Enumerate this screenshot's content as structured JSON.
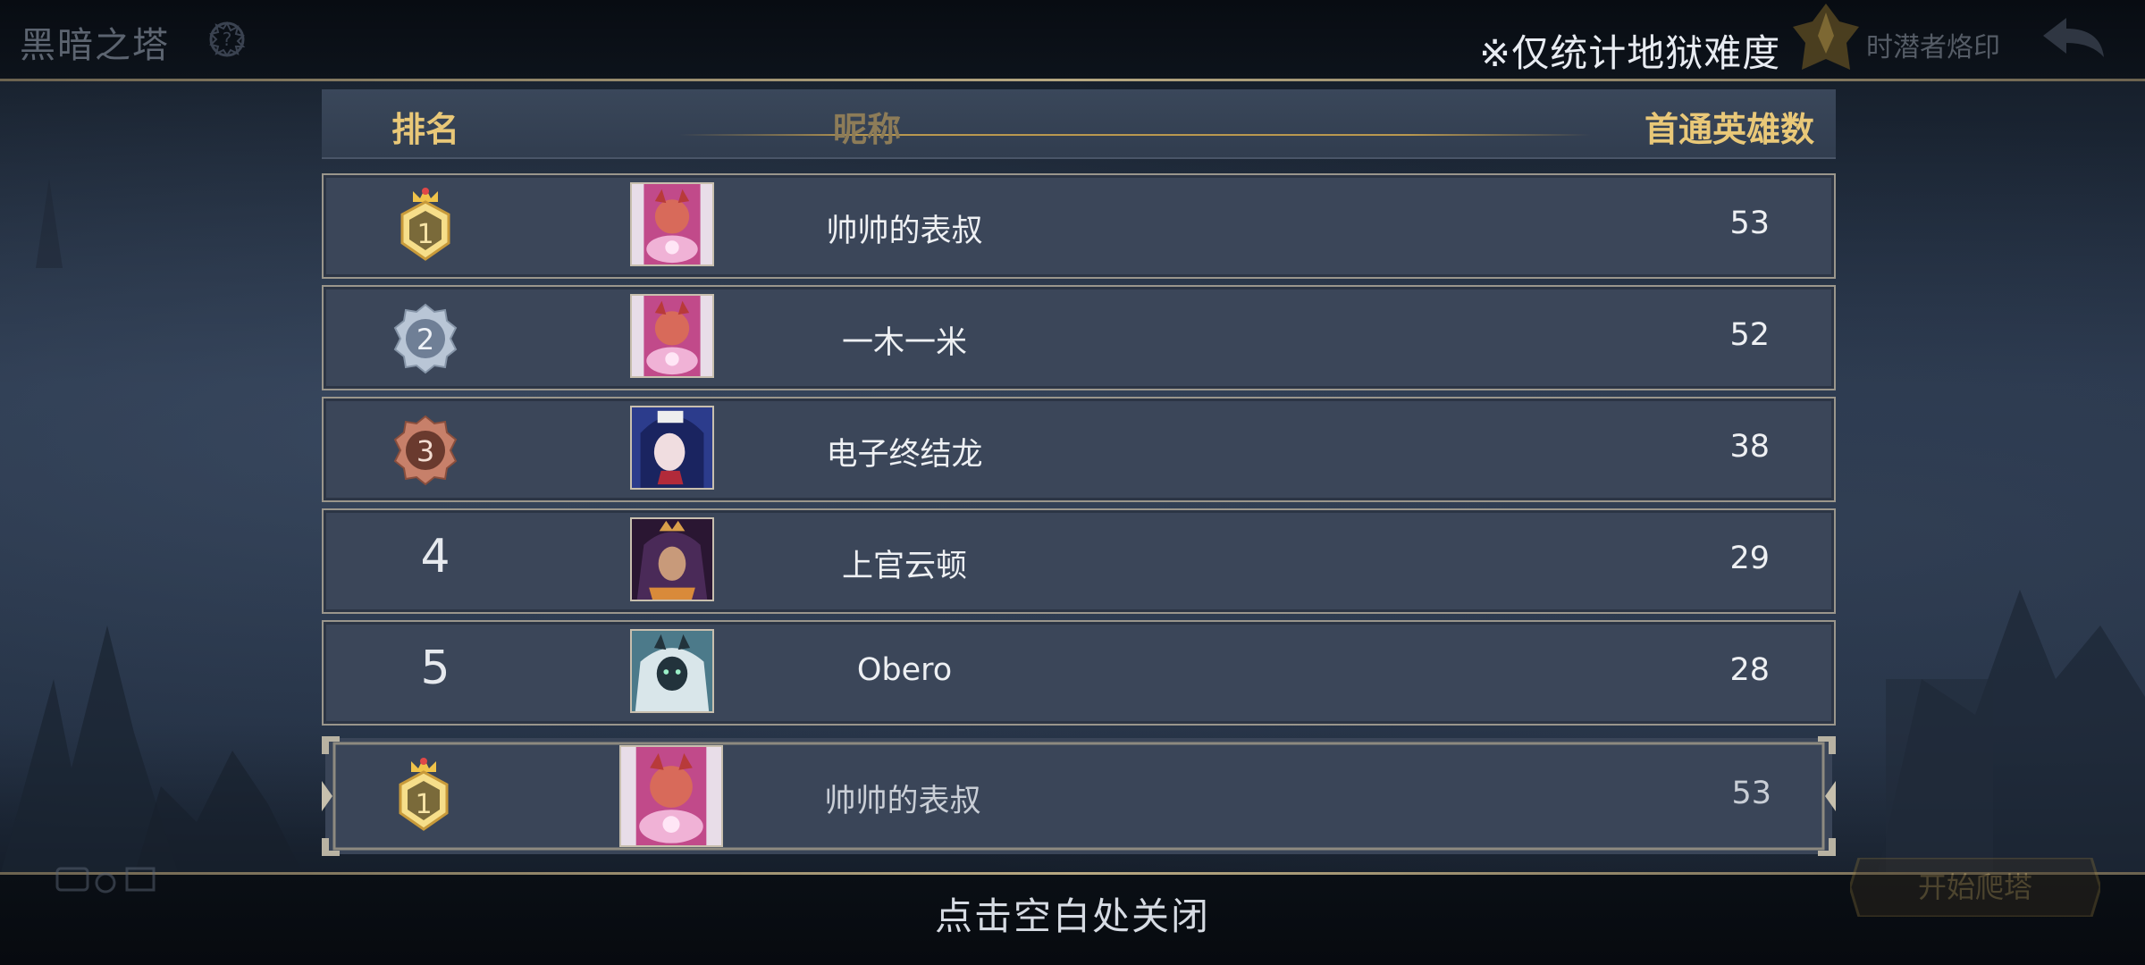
{
  "topbar": {
    "title": "黑暗之塔",
    "note": "※仅统计地狱难度",
    "brand_label": "时潜者烙印"
  },
  "header": {
    "rank": "排名",
    "nickname": "昵称",
    "count": "首通英雄数"
  },
  "rows": [
    {
      "rank": "1",
      "medal": "gold",
      "name": "帅帅的表叔",
      "count": "53",
      "avatar_colors": [
        "#c14a8a",
        "#f0b2d6",
        "#7a2a5c"
      ]
    },
    {
      "rank": "2",
      "medal": "silver",
      "name": "一木一米",
      "count": "52",
      "avatar_colors": [
        "#c14a8a",
        "#f0b2d6",
        "#7a2a5c"
      ]
    },
    {
      "rank": "3",
      "medal": "bronze",
      "name": "电子终结龙",
      "count": "38",
      "avatar_colors": [
        "#2c3c8c",
        "#e9d7e2",
        "#1a2460"
      ]
    },
    {
      "rank": "4",
      "medal": "none",
      "name": "上官云顿",
      "count": "29",
      "avatar_colors": [
        "#4a2a58",
        "#d9a04a",
        "#2a1632"
      ]
    },
    {
      "rank": "5",
      "medal": "none",
      "name": "Obero",
      "count": "28",
      "avatar_colors": [
        "#4c7a8a",
        "#d9e6ea",
        "#22333c"
      ]
    }
  ],
  "self": {
    "rank": "1",
    "medal": "gold",
    "name": "帅帅的表叔",
    "count": "53"
  },
  "bottom": {
    "close_hint": "点击空白处关闭",
    "start_button": "开始爬塔"
  },
  "colors": {
    "gold_text": "#e9c878",
    "row_bg": "#3b4659",
    "frame": "#9a968c"
  }
}
